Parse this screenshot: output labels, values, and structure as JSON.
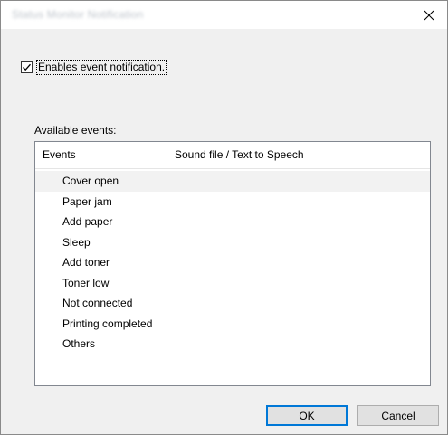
{
  "window": {
    "title": "Status Monitor Notification"
  },
  "checkbox": {
    "label": "Enables event notification.",
    "checked": true
  },
  "events_section": {
    "label": "Available events:"
  },
  "table": {
    "columns": [
      "Events",
      "Sound file / Text to Speech"
    ],
    "rows": [
      {
        "event": "Cover open",
        "sound": "",
        "selected": true
      },
      {
        "event": "Paper jam",
        "sound": ""
      },
      {
        "event": "Add paper",
        "sound": ""
      },
      {
        "event": "Sleep",
        "sound": ""
      },
      {
        "event": "Add toner",
        "sound": ""
      },
      {
        "event": "Toner low",
        "sound": ""
      },
      {
        "event": "Not connected",
        "sound": ""
      },
      {
        "event": "Printing completed",
        "sound": ""
      },
      {
        "event": "Others",
        "sound": ""
      }
    ]
  },
  "buttons": {
    "ok_label": "OK",
    "cancel_label": "Cancel"
  },
  "icons": {
    "close": "close-icon",
    "check": "checkmark-icon"
  },
  "colors": {
    "accent": "#0078d7",
    "window_bg": "#f0f0f0",
    "selected_row": "#f2f2f2"
  }
}
